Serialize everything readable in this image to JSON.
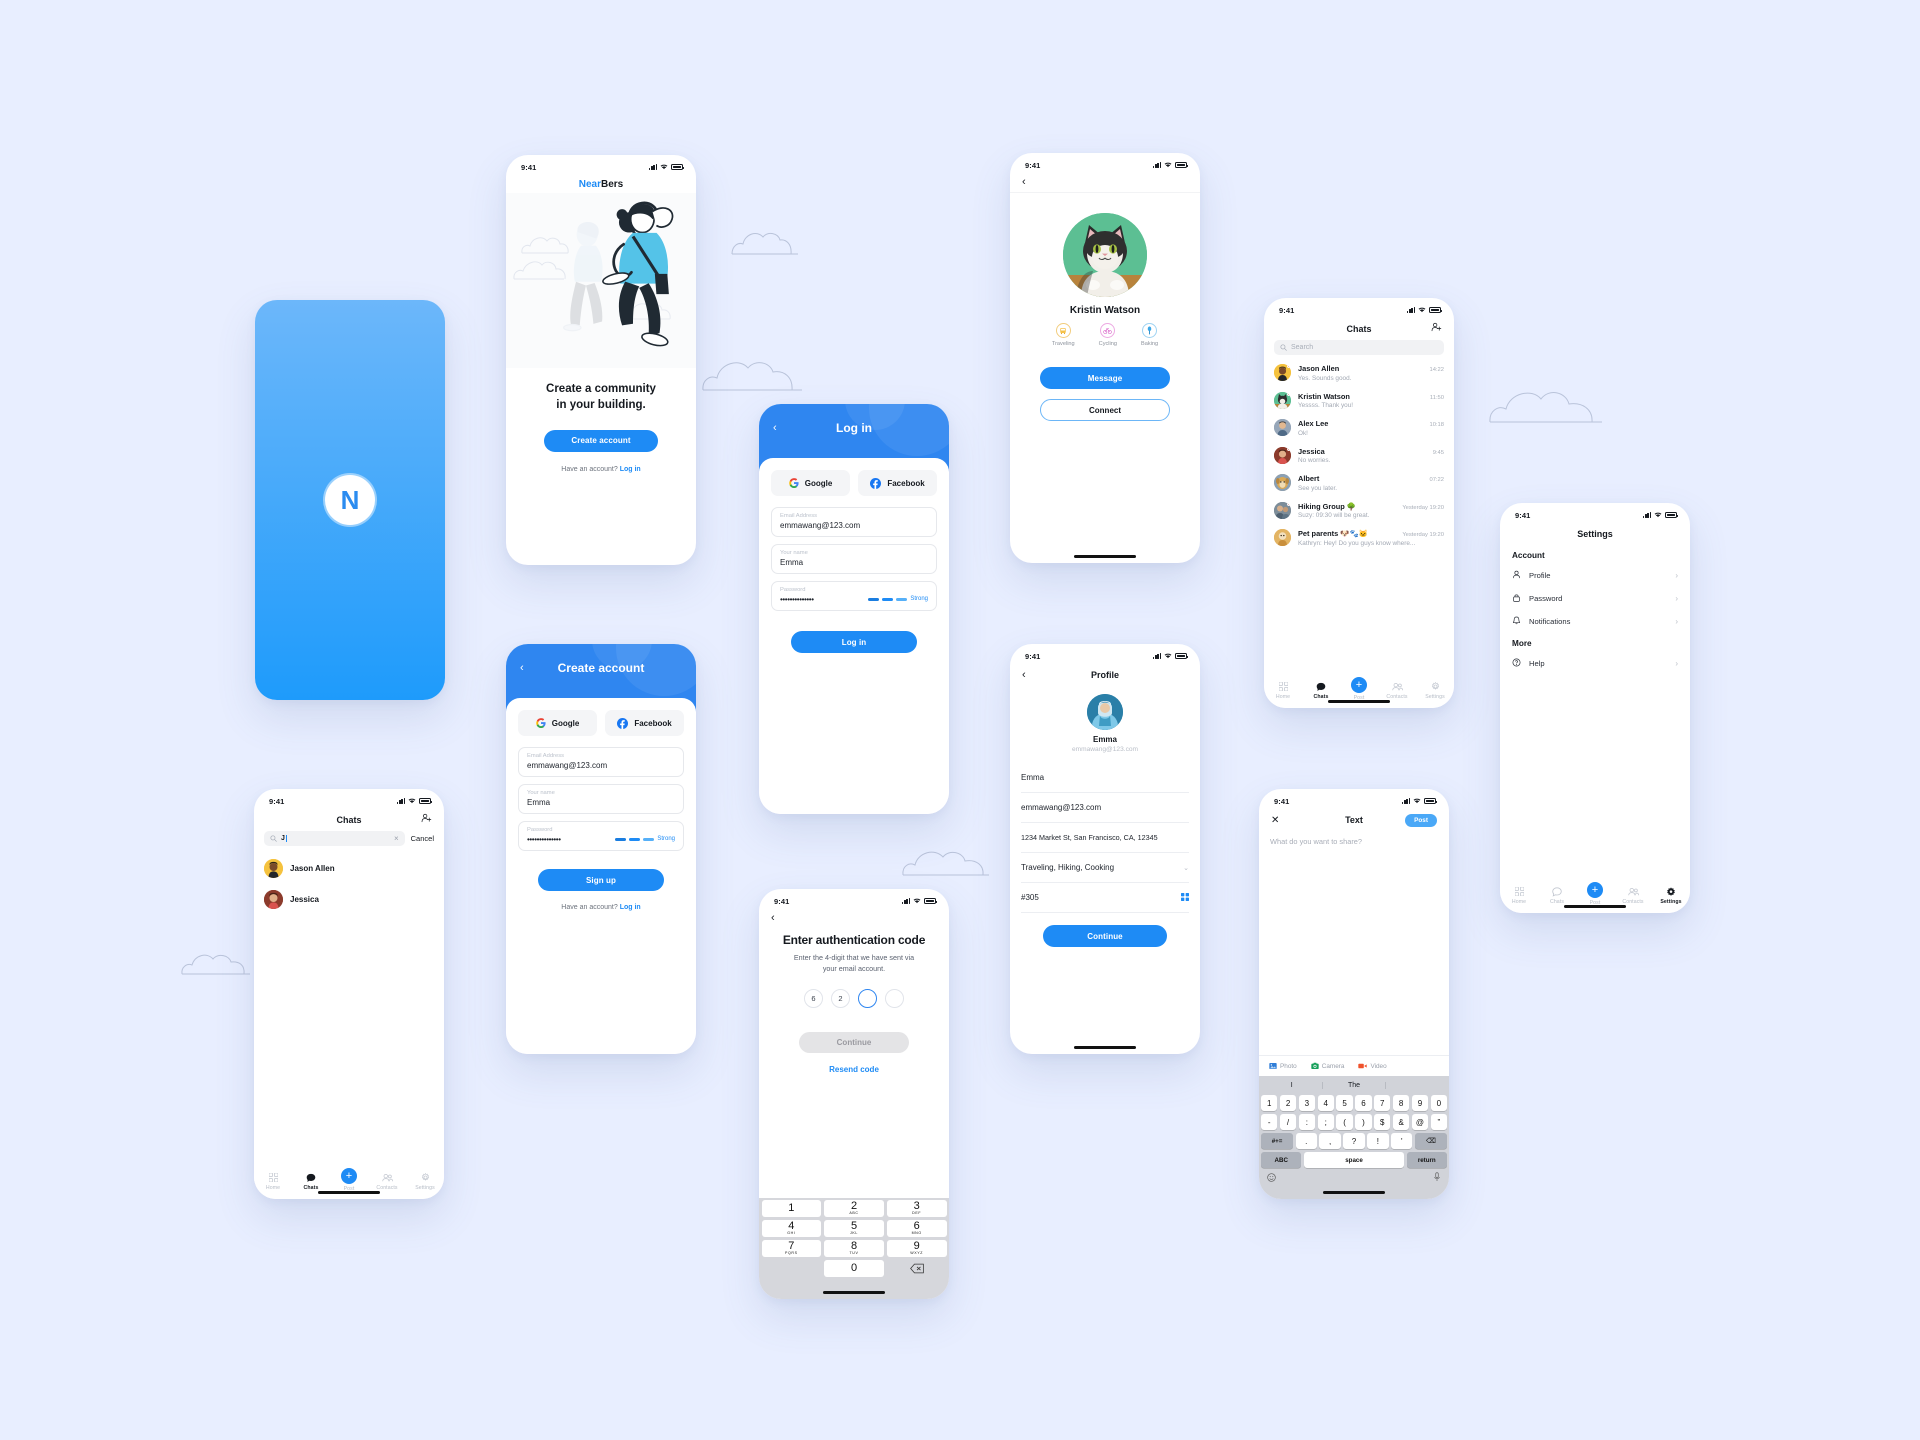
{
  "meta": {
    "background": "#e8eeff",
    "accent": "#1e8bf5",
    "brand": "NearBers"
  },
  "status_bar": {
    "time": "9:41"
  },
  "splash": {
    "logo_letter": "N"
  },
  "onboarding": {
    "brand_near": "Near",
    "brand_bers": "Bers",
    "headline_line1": "Create a community",
    "headline_line2": "in  your building.",
    "cta": "Create account",
    "footer_text": "Have an account?",
    "footer_link": "Log in"
  },
  "login": {
    "title": "Log in",
    "back": "‹",
    "google": "Google",
    "facebook": "Facebook",
    "email_label": "Email Address",
    "email_value": "emmawang@123.com",
    "name_label": "Your name",
    "name_value": "Emma",
    "password_label": "Password",
    "password_value": "••••••••••••••",
    "strength": "Strong",
    "submit": "Log in"
  },
  "signup": {
    "title": "Create account",
    "back": "‹",
    "google": "Google",
    "facebook": "Facebook",
    "email_label": "Email Address",
    "email_value": "emmawang@123.com",
    "name_label": "Your name",
    "name_value": "Emma",
    "password_label": "Password",
    "password_value": "••••••••••••••",
    "strength": "Strong",
    "submit": "Sign up",
    "footer_text": "Have an account?",
    "footer_link": "Log in"
  },
  "auth_code": {
    "back": "‹",
    "title": "Enter authentication code",
    "subtitle_line1": "Enter the 4-digit that we have sent via",
    "subtitle_line2": "your email account.",
    "digits": [
      "6",
      "2",
      "",
      ""
    ],
    "active_index": 2,
    "continue": "Continue",
    "resend": "Resend code",
    "keypad": [
      {
        "num": "1",
        "alp": ""
      },
      {
        "num": "2",
        "alp": "ABC"
      },
      {
        "num": "3",
        "alp": "DEF"
      },
      {
        "num": "4",
        "alp": "GHI"
      },
      {
        "num": "5",
        "alp": "JKL"
      },
      {
        "num": "6",
        "alp": "MNO"
      },
      {
        "num": "7",
        "alp": "PQRS"
      },
      {
        "num": "8",
        "alp": "TUV"
      },
      {
        "num": "9",
        "alp": "WXYZ"
      },
      {
        "num": "0",
        "alp": ""
      }
    ]
  },
  "profile_view": {
    "back": "‹",
    "name": "Kristin Watson",
    "interests": [
      {
        "label": "Traveling",
        "icon": "bus-icon",
        "color": "#f2b23e"
      },
      {
        "label": "Cycling",
        "icon": "bicycle-icon",
        "color": "#d556c4"
      },
      {
        "label": "Baking",
        "icon": "whisk-icon",
        "color": "#3aa7e8"
      }
    ],
    "message": "Message",
    "connect": "Connect"
  },
  "profile_edit": {
    "back": "‹",
    "title": "Profile",
    "name": "Emma",
    "email_sub": "emmawang@123.com",
    "fields": [
      {
        "value": "Emma",
        "icon": ""
      },
      {
        "value": "emmawang@123.com",
        "icon": ""
      },
      {
        "value": "1234 Market St, San Francisco, CA, 12345",
        "icon": ""
      },
      {
        "value": "Traveling, Hiking, Cooking",
        "icon": "chevron-down-icon"
      },
      {
        "value": "#305",
        "icon": "grid-icon"
      }
    ],
    "continue": "Continue"
  },
  "chats": {
    "title": "Chats",
    "add_icon": "add-person-icon",
    "search_placeholder": "Search",
    "rows": [
      {
        "name": "Jason Allen",
        "time": "14:22",
        "msg": "Yes. Sounds good.",
        "unread": true,
        "color": "#f5c23e"
      },
      {
        "name": "Kristin Watson",
        "time": "11:50",
        "msg": "Yessss. Thank you!",
        "unread": true,
        "color": "#54b48a"
      },
      {
        "name": "Alex Lee",
        "time": "10:18",
        "msg": "Ok!",
        "unread": false,
        "color": "#7f93ab"
      },
      {
        "name": "Jessica",
        "time": "9:45",
        "msg": "No worries.",
        "unread": true,
        "color": "#8c3b2c"
      },
      {
        "name": "Albert",
        "time": "07:22",
        "msg": "See you later.",
        "unread": false,
        "color": "#b9925e"
      },
      {
        "name": "Hiking Group 🌳",
        "time": "Yesterday 19:20",
        "msg": "Suzy: 09:30 will be great.",
        "unread": true,
        "color": "#6e7f8c"
      },
      {
        "name": "Pet parents 🐶🐾🐱",
        "time": "Yesterday 19:20",
        "msg": "Kathryn: Hey! Do you guys know where...",
        "unread": false,
        "color": "#e0a64b"
      }
    ]
  },
  "chats_search": {
    "title": "Chats",
    "query": "J",
    "cancel": "Cancel",
    "clear_icon": "close-icon",
    "results": [
      {
        "name": "Jason Allen",
        "color": "#f5c23e"
      },
      {
        "name": "Jessica",
        "color": "#8c3b2c"
      }
    ]
  },
  "settings": {
    "title": "Settings",
    "sections": [
      {
        "heading": "Account",
        "items": [
          {
            "label": "Profile",
            "icon": "person-icon"
          },
          {
            "label": "Password",
            "icon": "lock-icon"
          },
          {
            "label": "Notifications",
            "icon": "bell-icon"
          }
        ]
      },
      {
        "heading": "More",
        "items": [
          {
            "label": "Help",
            "icon": "question-icon"
          }
        ]
      }
    ],
    "chevron": "›"
  },
  "composer": {
    "close_icon": "close-icon",
    "title": "Text",
    "post": "Post",
    "placeholder": "What do you want to share?",
    "media": [
      {
        "label": "Photo",
        "icon": "photo-icon",
        "color": "#2f7ed8"
      },
      {
        "label": "Camera",
        "icon": "camera-icon",
        "color": "#17a05a"
      },
      {
        "label": "Video",
        "icon": "video-icon",
        "color": "#f0522b"
      }
    ],
    "keyboard": {
      "predictions": [
        "I",
        "The",
        ""
      ],
      "row1": [
        "1",
        "2",
        "3",
        "4",
        "5",
        "6",
        "7",
        "8",
        "9",
        "0"
      ],
      "row2": [
        "-",
        "/",
        ":",
        ";",
        "(",
        ")",
        "$",
        "&",
        "@",
        "”"
      ],
      "row3_left": "#+=",
      "row3": [
        ".",
        ",",
        "?",
        "!",
        "'"
      ],
      "row3_right": "⌫",
      "abc": "ABC",
      "space": "space",
      "return": "return",
      "emoji_icon": "emoji-icon",
      "mic_icon": "microphone-icon"
    }
  },
  "tabbar": {
    "items": [
      {
        "label": "Home",
        "icon": "grid-icon"
      },
      {
        "label": "Chats",
        "icon": "chat-icon"
      },
      {
        "label": "Post",
        "icon": "plus-icon"
      },
      {
        "label": "Contacts",
        "icon": "contacts-icon"
      },
      {
        "label": "Settings",
        "icon": "gear-icon"
      }
    ]
  }
}
